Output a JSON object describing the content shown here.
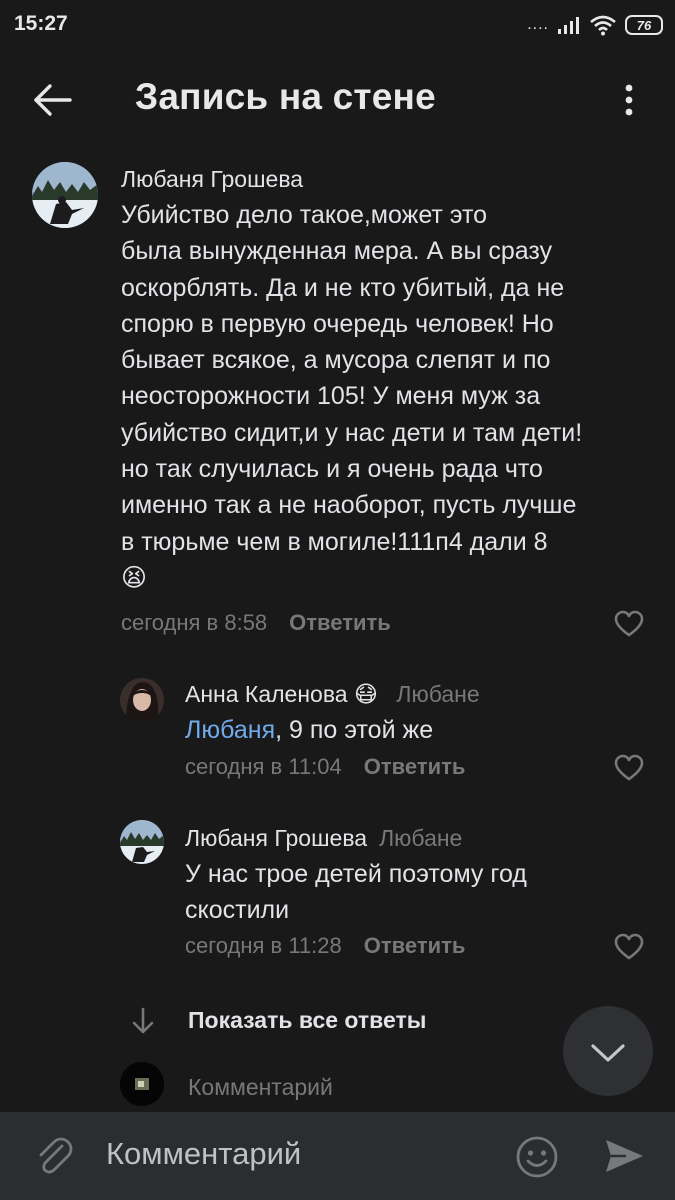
{
  "status_bar": {
    "time": "15:27",
    "signal_dots": "....",
    "battery": "76"
  },
  "header": {
    "title": "Запись на стене"
  },
  "comments": [
    {
      "author": "Любаня Грошева",
      "reply_to": "",
      "mention": "",
      "text_lines": [
        "Убийство дело такое,может это",
        "была вынужденная мера. А вы сразу",
        "оскорблять. Да и не кто убитый, да не",
        "спорю в первую очередь человек! Но",
        "бывает всякое, а мусора слепят  и по",
        "неосторожности 105! У меня муж за",
        "убийство сидит,и у нас дети и там дети!",
        "но так случилась и я очень рада что",
        "именно так а не наоборот, пусть лучше",
        "в тюрьме чем в могиле!111п4 дали 8"
      ],
      "emoji": "😫",
      "time": "сегодня в 8:58",
      "reply_label": "Ответить"
    },
    {
      "author": "Анна Каленова",
      "author_emoji": "😷",
      "reply_to": "Любане",
      "mention": "Любаня",
      "text": ", 9 по этой же",
      "time": "сегодня в 11:04",
      "reply_label": "Ответить"
    },
    {
      "author": "Любаня Грошева",
      "reply_to": "Любане",
      "text_lines": [
        "У нас трое детей поэтому год",
        "скостили"
      ],
      "time": "сегодня в 11:28",
      "reply_label": "Ответить"
    }
  ],
  "show_all_replies": "Показать все ответы",
  "inline_comment_placeholder": "Комментарий",
  "composer": {
    "placeholder": "Комментарий"
  },
  "colors": {
    "background": "#19191a",
    "accent": "#71aaeb",
    "secondary_text": "#76787a",
    "bar": "#2c2d2f"
  }
}
